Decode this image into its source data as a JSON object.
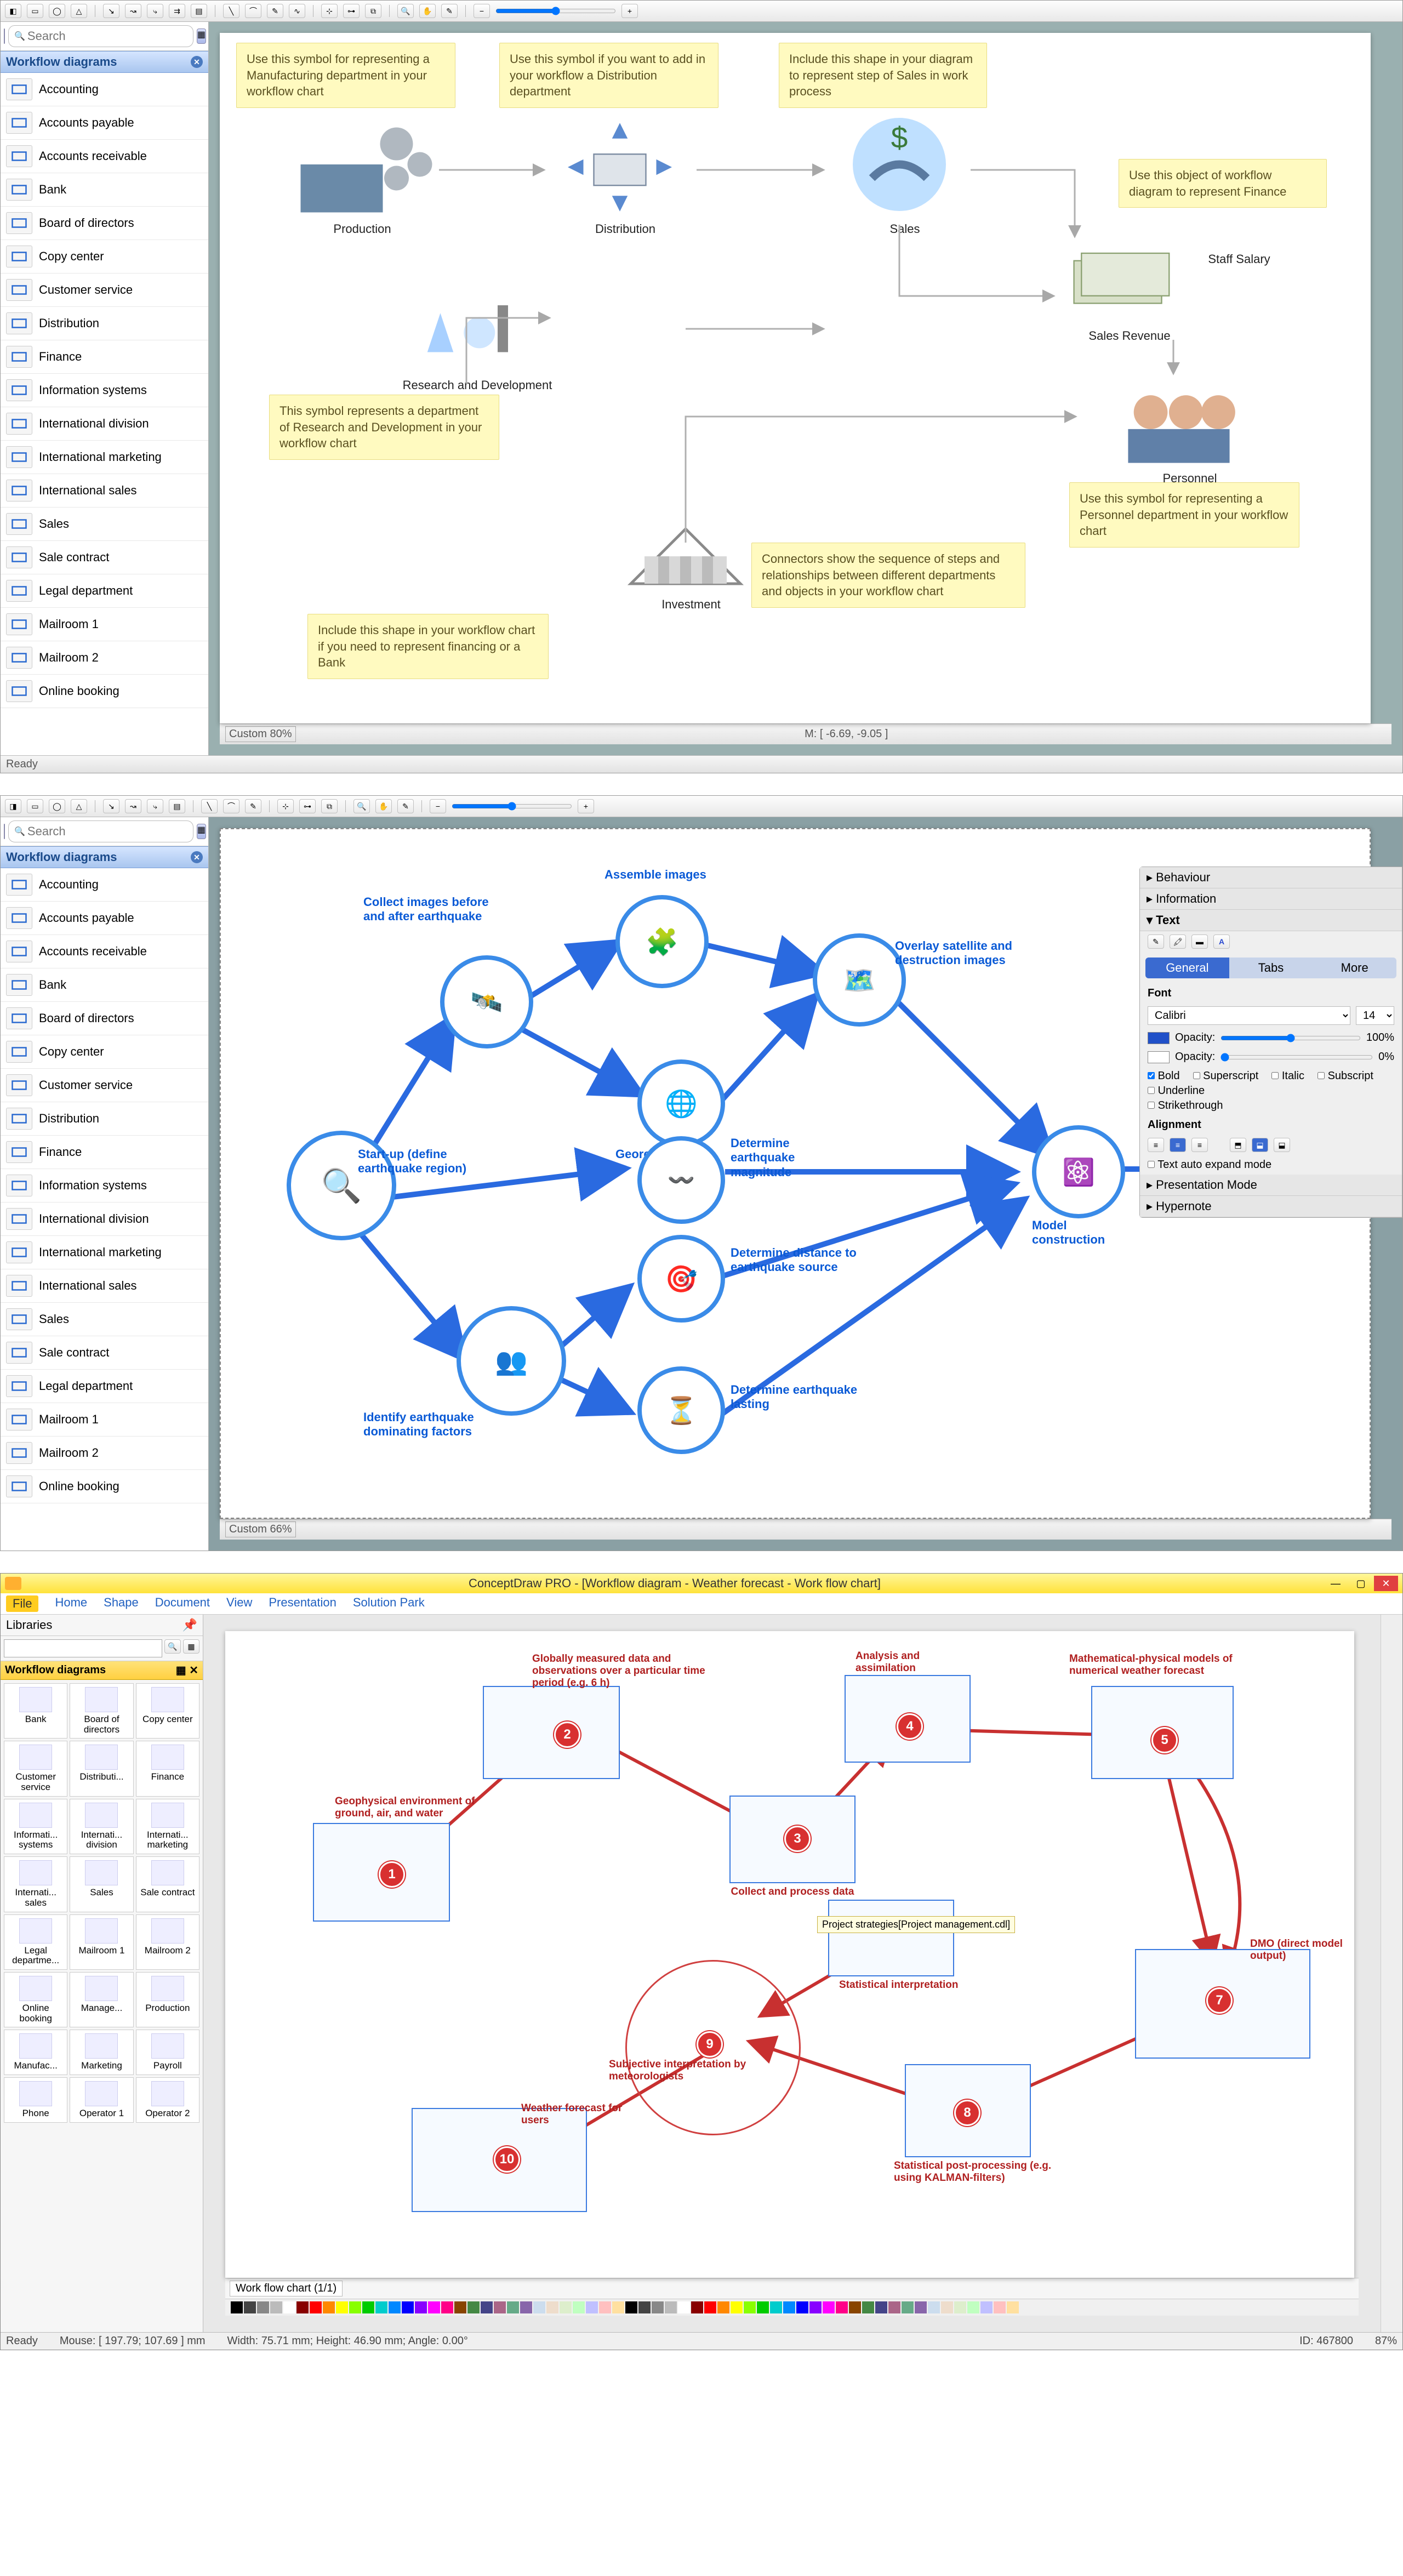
{
  "sidebar": {
    "header": "Workflow diagrams",
    "search_placeholder": "Search",
    "items": [
      {
        "label": "Accounting"
      },
      {
        "label": "Accounts payable"
      },
      {
        "label": "Accounts receivable"
      },
      {
        "label": "Bank"
      },
      {
        "label": "Board of directors"
      },
      {
        "label": "Copy center"
      },
      {
        "label": "Customer service"
      },
      {
        "label": "Distribution"
      },
      {
        "label": "Finance"
      },
      {
        "label": "Information systems"
      },
      {
        "label": "International division"
      },
      {
        "label": "International marketing"
      },
      {
        "label": "International sales"
      },
      {
        "label": "Sales"
      },
      {
        "label": "Sale contract"
      },
      {
        "label": "Legal department"
      },
      {
        "label": "Mailroom 1"
      },
      {
        "label": "Mailroom 2"
      },
      {
        "label": "Online booking"
      }
    ]
  },
  "app1": {
    "zoom": "Custom 80%",
    "status": "Ready",
    "mouse": "M: [ -6.69, -9.05 ]",
    "notes": {
      "n1": "Use this symbol for representing a Manufacturing department in your workflow chart",
      "n2": "Use this symbol if you want to add in your workflow a Distribution department",
      "n3": "Include this shape in your diagram to represent step of Sales in work process",
      "n4": "Use this object of workflow diagram to represent Finance",
      "n5": "This symbol represents a department of Research and Development in your workflow chart",
      "n6": "Use this symbol for representing a Personnel department in your workflow chart",
      "n7": "Connectors show the sequence of steps and relationships between different departments and objects in your workflow chart",
      "n8": "Include this shape in your workflow chart if you need to represent financing or a Bank"
    },
    "labels": {
      "production": "Production",
      "distribution": "Distribution",
      "sales": "Sales",
      "staff": "Staff Salary",
      "revenue": "Sales Revenue",
      "rnd": "Research and Development",
      "personnel": "Personnel",
      "investment": "Investment"
    }
  },
  "app2": {
    "zoom": "Custom 66%",
    "labels": {
      "collect": "Collect images before and after earthquake",
      "assemble": "Assemble images",
      "overlay": "Overlay satellite and destruction images",
      "geo": "Georeferencing",
      "start": "Start-up (define earthquake region)",
      "mag": "Determine earthquake magnitude",
      "model": "Model construction",
      "identify": "Identify earthquake dominating factors",
      "dist": "Determine distance to earthquake source",
      "lasting": "Determine earthquake lasting"
    },
    "fmt": {
      "behaviour": "Behaviour",
      "information": "Information",
      "text": "Text",
      "tab_general": "General",
      "tab_tabs": "Tabs",
      "tab_more": "More",
      "font_lbl": "Font",
      "font": "Calibri",
      "size": "14",
      "opacity_lbl": "Opacity:",
      "opacity1": "100%",
      "opacity2": "0%",
      "bold": "Bold",
      "italic": "Italic",
      "underline": "Underline",
      "strike": "Strikethrough",
      "sup": "Superscript",
      "sub": "Subscript",
      "alignment": "Alignment",
      "autoexpand": "Text auto expand mode",
      "presentation": "Presentation Mode",
      "hypernote": "Hypernote"
    }
  },
  "app3": {
    "title": "ConceptDraw PRO - [Workflow diagram - Weather forecast - Work flow chart]",
    "menus": [
      "File",
      "Home",
      "Shape",
      "Document",
      "View",
      "Presentation",
      "Solution Park"
    ],
    "libraries_lbl": "Libraries",
    "lib_header": "Workflow diagrams",
    "lib_items": [
      "Bank",
      "Board of directors",
      "Copy center",
      "Customer service",
      "Distributi...",
      "Finance",
      "Informati... systems",
      "Internati... division",
      "Internati... marketing",
      "Internati... sales",
      "Sales",
      "Sale contract",
      "Legal departme...",
      "Mailroom 1",
      "Mailroom 2",
      "Online booking",
      "Manage...",
      "Production",
      "Manufac...",
      "Marketing",
      "Payroll",
      "Phone",
      "Operator 1",
      "Operator 2"
    ],
    "canvas_labels": {
      "l1": "Geophysical environment of ground, air, and water",
      "l2": "Globally measured data and observations over a particular time period (e.g. 6 h)",
      "l3": "Collect and process data",
      "l4": "Analysis and assimilation",
      "l5": "Mathematical-physical models of numerical weather forecast",
      "l7": "DMO (direct model output)",
      "l8": "Statistical post-processing (e.g. using KALMAN-filters)",
      "l9s": "Statistical interpretation",
      "l9": "Subjective interpretation by meteorologists",
      "l10": "Weather forecast for users",
      "tooltip": "Project strategies[Project management.cdl]"
    },
    "tab_name": "Work flow chart (1/1)",
    "status": {
      "ready": "Ready",
      "mouse": "Mouse: [ 197.79; 107.69 ] mm",
      "size": "Width: 75.71 mm; Height: 46.90 mm; Angle: 0.00°",
      "id": "ID: 467800",
      "zoom": "87%"
    }
  }
}
